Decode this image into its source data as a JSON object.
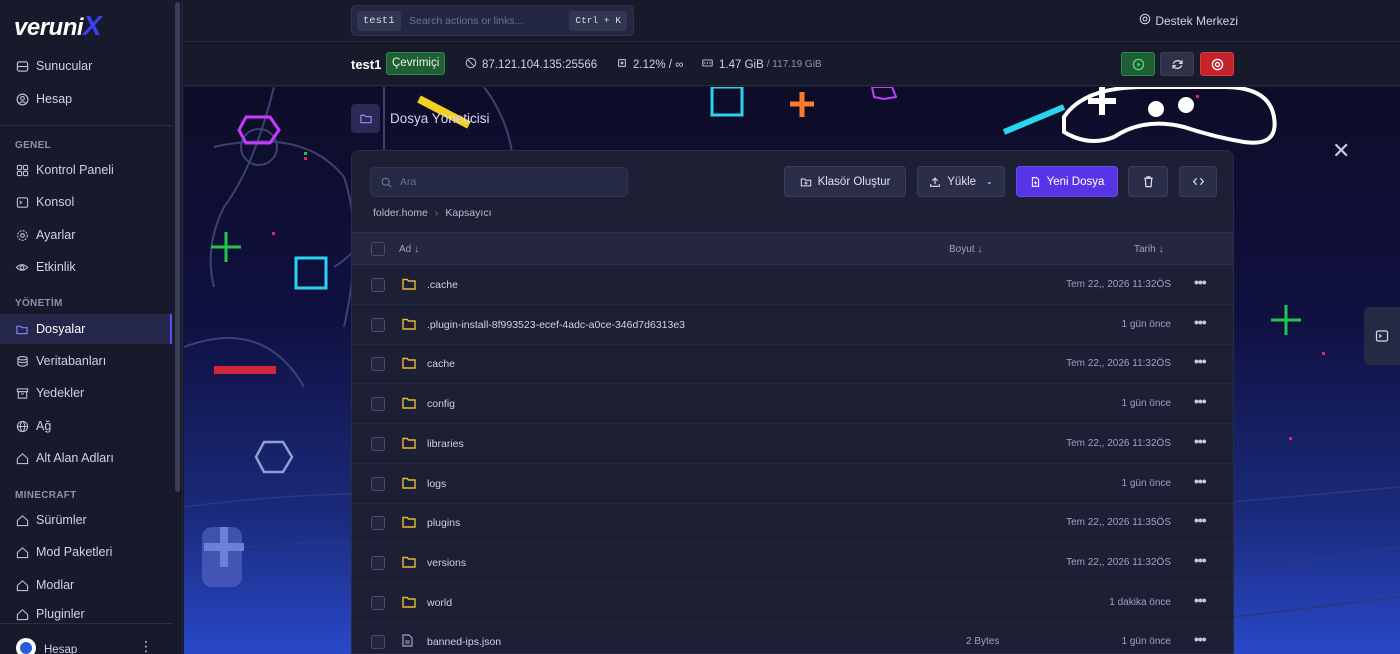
{
  "brand": {
    "name": "veruni",
    "mark": "X"
  },
  "sidebar": {
    "top_items": [
      {
        "label": "Sunucular"
      },
      {
        "label": "Hesap"
      }
    ],
    "sections": [
      {
        "title": "GENEL"
      },
      {
        "title": "YÖNETİM"
      },
      {
        "title": "MINECRAFT"
      }
    ],
    "items": [
      {
        "label": "Kontrol Paneli"
      },
      {
        "label": "Konsol"
      },
      {
        "label": "Ayarlar"
      },
      {
        "label": "Etkinlik"
      },
      {
        "label": "Dosyalar"
      },
      {
        "label": "Veritabanları"
      },
      {
        "label": "Yedekler"
      },
      {
        "label": "Ağ"
      },
      {
        "label": "Alt Alan Adları"
      },
      {
        "label": "Sürümler"
      },
      {
        "label": "Mod Paketleri"
      },
      {
        "label": "Modlar"
      },
      {
        "label": "Pluginler"
      }
    ],
    "active": "Dosyalar",
    "account_label": "Hesap"
  },
  "topbar": {
    "server_tag": "test1",
    "search_placeholder": "Search actions or links...",
    "shortcut": "Ctrl + K",
    "support_label": "Destek Merkezi"
  },
  "server": {
    "name": "test1",
    "status": "Çevrimiçi",
    "address": "87.121.104.135:25566",
    "cpu": "2.12% / ∞",
    "memory": "1.47 GiB",
    "memory_total": "/ 117.19 GiB"
  },
  "page": {
    "title": "Dosya Yöneticisi"
  },
  "files": {
    "search_placeholder": "Ara",
    "buttons": {
      "create_folder": "Klasör Oluştur",
      "upload": "Yükle",
      "new_file": "Yeni Dosya"
    },
    "breadcrumb": [
      "folder.home",
      "Kapsayıcı"
    ],
    "columns": {
      "name": "Ad",
      "size": "Boyut",
      "date": "Tarih"
    },
    "rows": [
      {
        "name": ".cache",
        "type": "folder",
        "size": "",
        "date": "Tem 22,, 2026 11:32ÖS"
      },
      {
        "name": ".plugin-install-8f993523-ecef-4adc-a0ce-346d7d6313e3",
        "type": "folder",
        "size": "",
        "date": "1 gün önce"
      },
      {
        "name": "cache",
        "type": "folder",
        "size": "",
        "date": "Tem 22,, 2026 11:32ÖS"
      },
      {
        "name": "config",
        "type": "folder",
        "size": "",
        "date": "1 gün önce"
      },
      {
        "name": "libraries",
        "type": "folder",
        "size": "",
        "date": "Tem 22,, 2026 11:32ÖS"
      },
      {
        "name": "logs",
        "type": "folder",
        "size": "",
        "date": "1 gün önce"
      },
      {
        "name": "plugins",
        "type": "folder",
        "size": "",
        "date": "Tem 22,, 2026 11:35ÖS"
      },
      {
        "name": "versions",
        "type": "folder",
        "size": "",
        "date": "Tem 22,, 2026 11:32ÖS"
      },
      {
        "name": "world",
        "type": "folder",
        "size": "",
        "date": "1 dakika önce"
      },
      {
        "name": "banned-ips.json",
        "type": "file",
        "size": "2 Bytes",
        "date": "1 gün önce"
      }
    ]
  },
  "colors": {
    "accent": "#5735e6",
    "online": "#1f5f33",
    "danger": "#c3242b",
    "folder": "#e8b83a"
  },
  "more_glyph": "•••"
}
